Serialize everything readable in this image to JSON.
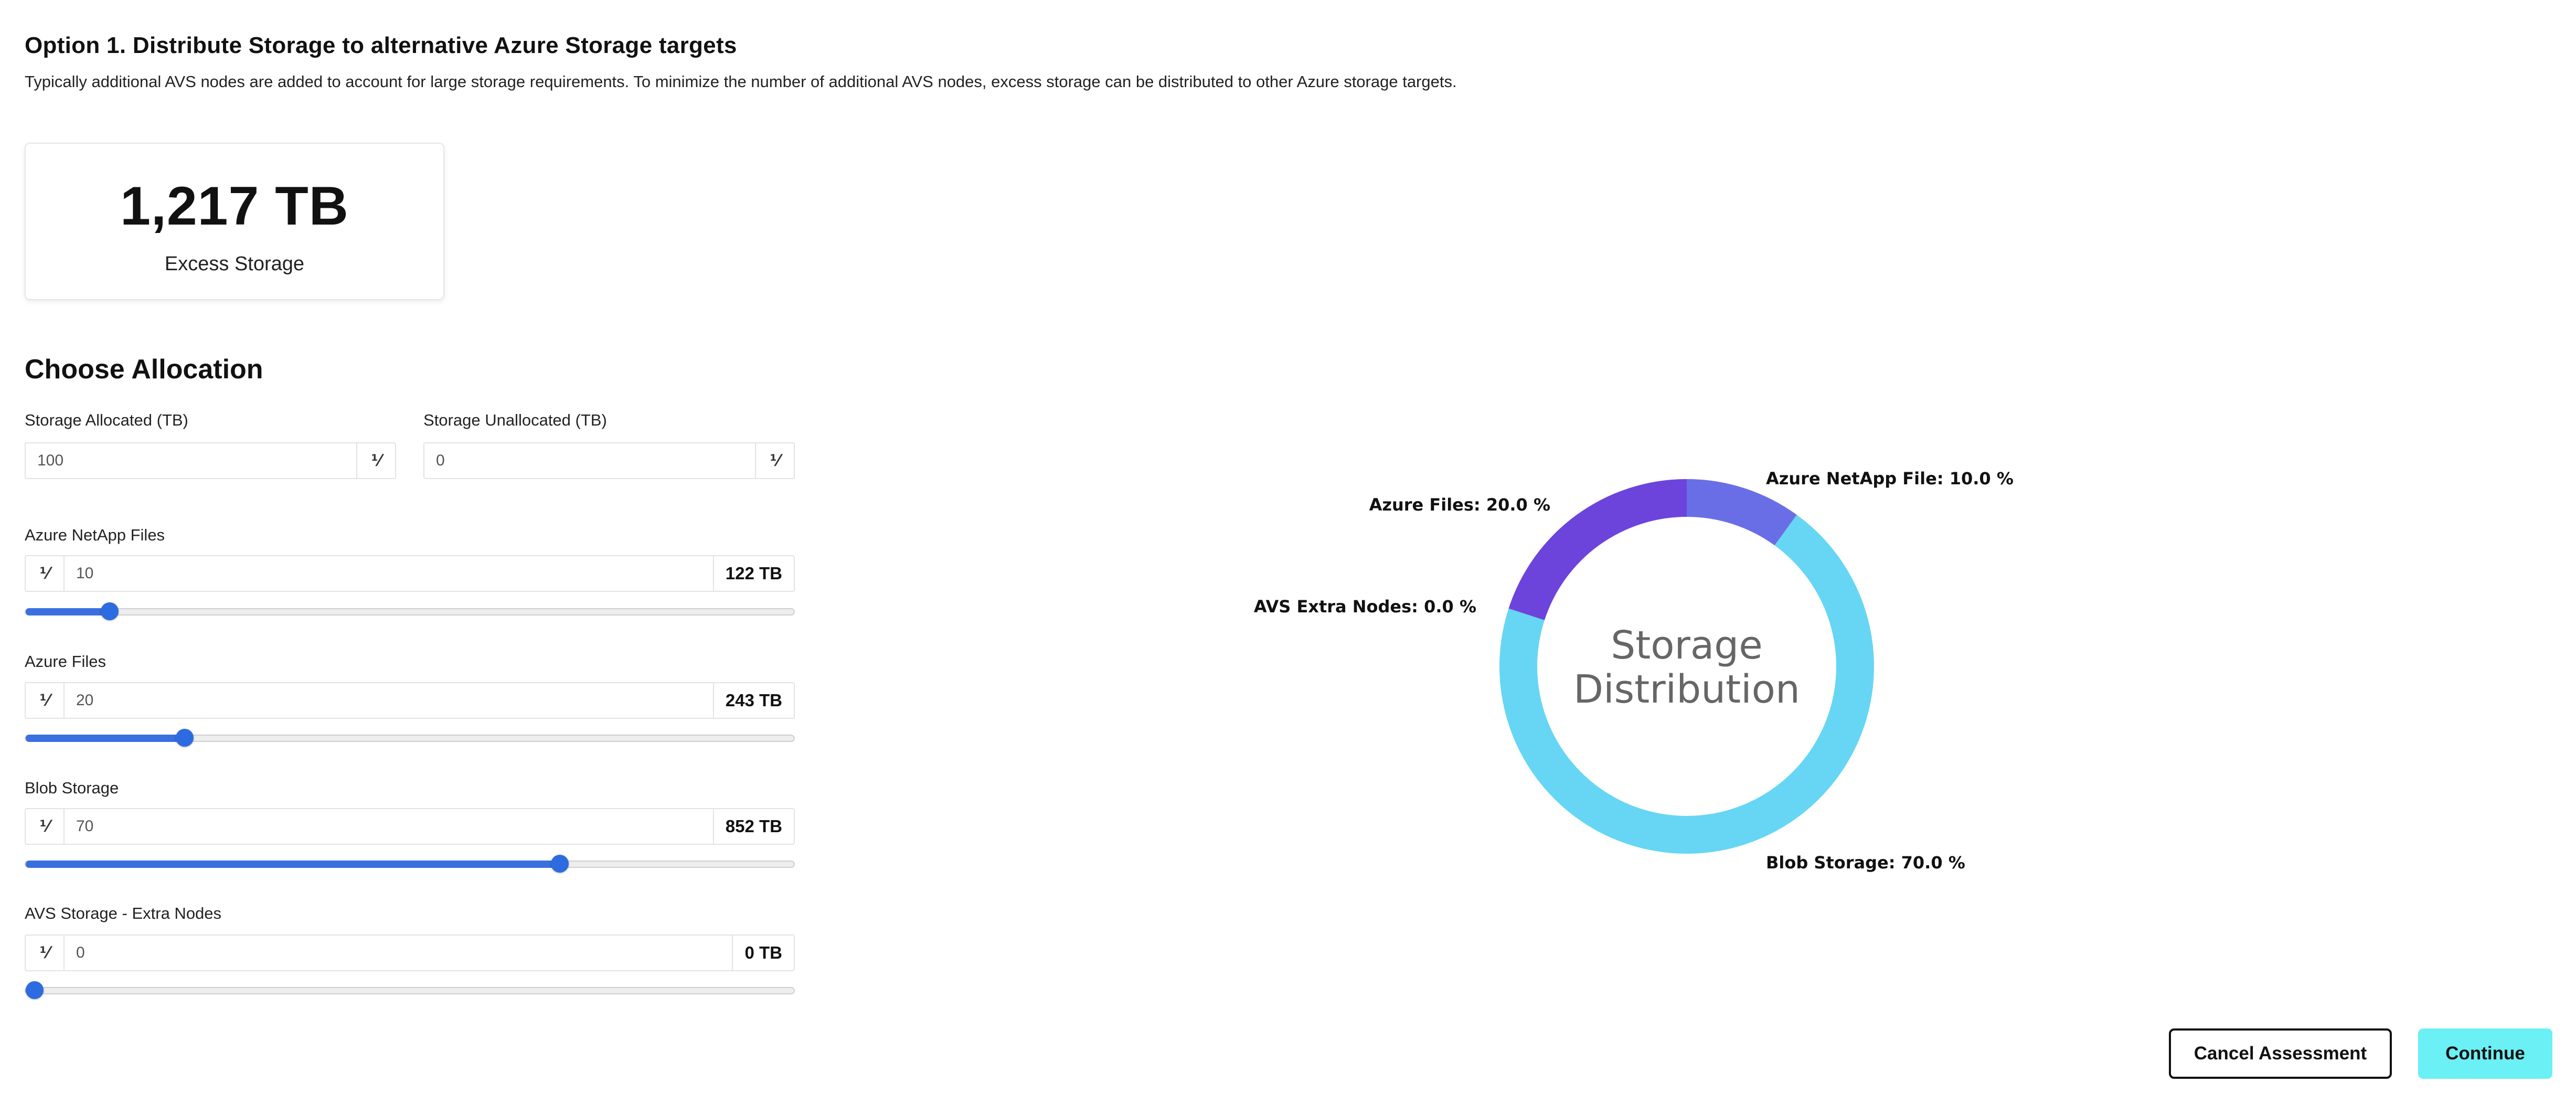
{
  "header": {
    "title": "Option 1. Distribute Storage to alternative Azure Storage targets",
    "description": "Typically additional AVS nodes are added to account for large storage requirements. To minimize the number of additional AVS nodes, excess storage can be distributed to other Azure storage targets."
  },
  "excess": {
    "value": "1,217 TB",
    "label": "Excess Storage"
  },
  "allocation": {
    "title": "Choose Allocation",
    "allocated": {
      "label": "Storage Allocated (TB)",
      "value": "100",
      "icon": "percent-icon"
    },
    "unallocated": {
      "label": "Storage Unallocated (TB)",
      "value": "0",
      "icon": "percent-icon"
    },
    "targets": [
      {
        "label": "Azure NetApp Files",
        "percent": "10",
        "tb": "122 TB",
        "fraction": 0.1
      },
      {
        "label": "Azure Files",
        "percent": "20",
        "tb": "243 TB",
        "fraction": 0.2
      },
      {
        "label": "Blob Storage",
        "percent": "70",
        "tb": "852 TB",
        "fraction": 0.7
      },
      {
        "label": "AVS Storage - Extra Nodes",
        "percent": "0",
        "tb": "0 TB",
        "fraction": 0.0
      }
    ]
  },
  "chart_data": {
    "type": "pie",
    "center_text": [
      "Storage",
      "Distribution"
    ],
    "slices": [
      {
        "label": "Azure NetApp File: 10.0 %",
        "value": 10.0,
        "color": "#6a6ee6"
      },
      {
        "label": "Blob Storage: 70.0 %",
        "value": 70.0,
        "color": "#66d6f4"
      },
      {
        "label": "AVS Extra Nodes: 0.0 %",
        "value": 0.0,
        "color": "#8a8a8a"
      },
      {
        "label": "Azure Files: 20.0 %",
        "value": 20.0,
        "color": "#6c44dc"
      }
    ]
  },
  "buttons": {
    "cancel": "Cancel Assessment",
    "continue": "Continue"
  },
  "colors": {
    "slider": "#3a6fe0",
    "continue_bg": "#6af0f5"
  }
}
